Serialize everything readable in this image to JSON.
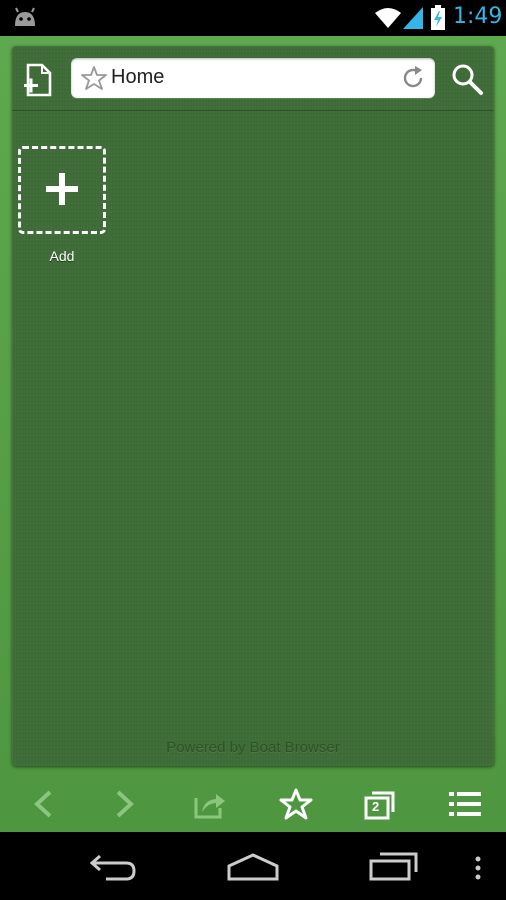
{
  "status_bar": {
    "time": "1:49",
    "icons": [
      "android-icon",
      "wifi-icon",
      "signal-icon",
      "battery-charging-icon"
    ],
    "accent_color": "#33b5e5"
  },
  "toolbar": {
    "address_title": "Home",
    "icons": [
      "new-tab-icon",
      "bookmark-star-icon",
      "reload-icon",
      "search-icon"
    ]
  },
  "speed_dial": {
    "add_label": "Add"
  },
  "footer": {
    "powered_by": "Powered by Boat Browser"
  },
  "bottom_bar": {
    "items": [
      "back-icon",
      "forward-icon",
      "share-icon",
      "bookmarks-star-icon",
      "tabs-icon",
      "menu-icon"
    ],
    "tab_count": "2"
  },
  "nav_bar": {
    "items": [
      "back-icon",
      "home-icon",
      "recent-apps-icon",
      "overflow-menu-icon"
    ]
  },
  "colors": {
    "app_background": "#5ea84f",
    "panel_background": "#3f6d38"
  }
}
